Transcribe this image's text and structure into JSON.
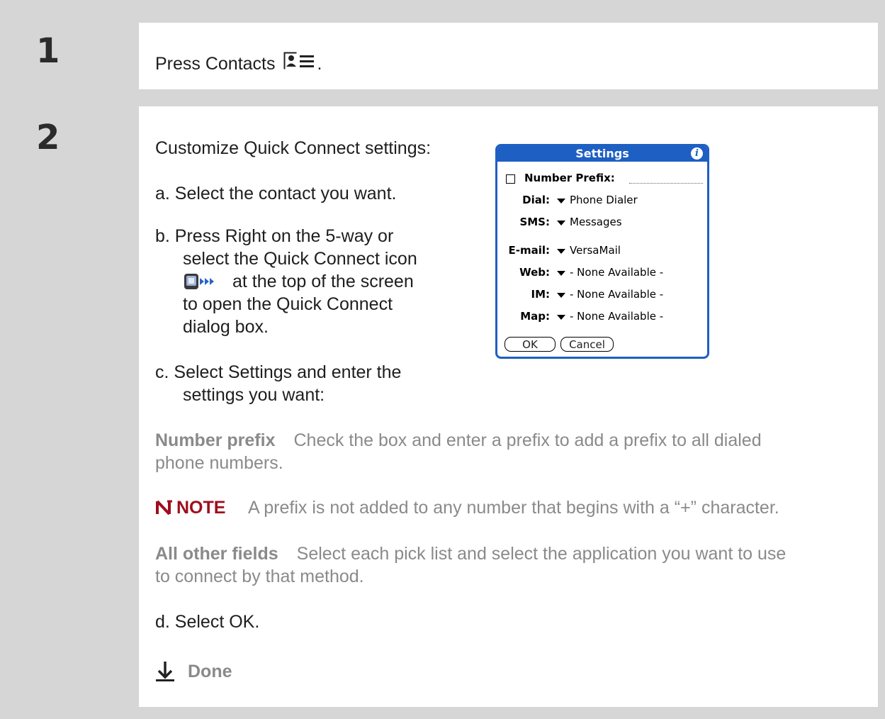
{
  "step1": {
    "number": "1",
    "text": "Press Contacts",
    "text_end": ".",
    "icon": "contacts-icon"
  },
  "step2": {
    "number": "2",
    "intro": "Customize Quick Connect settings:",
    "a": "a.  Select the contact you want.",
    "b_line1": "b.  Press Right on the 5-way or",
    "b_line2": "select the Quick Connect icon",
    "b_line3": "at the top of the screen",
    "b_line4": "to open the Quick Connect",
    "b_line5": "dialog box.",
    "quick_connect_icon": "quick-connect-icon",
    "c_line1": "c.  Select Settings and enter the",
    "c_line2": "settings you want:",
    "number_prefix_term": "Number prefix",
    "number_prefix_desc_line1": "Check the box and enter a prefix to add a prefix to all dialed",
    "number_prefix_desc_line2": "phone numbers.",
    "note_label": "NOTE",
    "note_text": "A prefix is not added to any number that begins with a “+” character.",
    "other_fields_term": "All other fields",
    "other_fields_desc_line1": "Select each pick list and select the application you want to use",
    "other_fields_desc_line2": "to connect by that method.",
    "d": "d.  Select OK.",
    "done_label": "Done"
  },
  "settings_dialog": {
    "title": "Settings",
    "info_glyph": "i",
    "number_prefix_label": "Number Prefix:",
    "number_prefix_checked": false,
    "rows": [
      {
        "label": "Dial:",
        "value": "Phone Dialer"
      },
      {
        "label": "SMS:",
        "value": "Messages"
      },
      {
        "label": "E-mail:",
        "value": "VersaMail"
      },
      {
        "label": "Web:",
        "value": "- None Available -"
      },
      {
        "label": "IM:",
        "value": "- None Available -"
      },
      {
        "label": "Map:",
        "value": "- None Available -"
      }
    ],
    "ok_label": "OK",
    "cancel_label": "Cancel",
    "accent_color": "#1e5fc3"
  }
}
